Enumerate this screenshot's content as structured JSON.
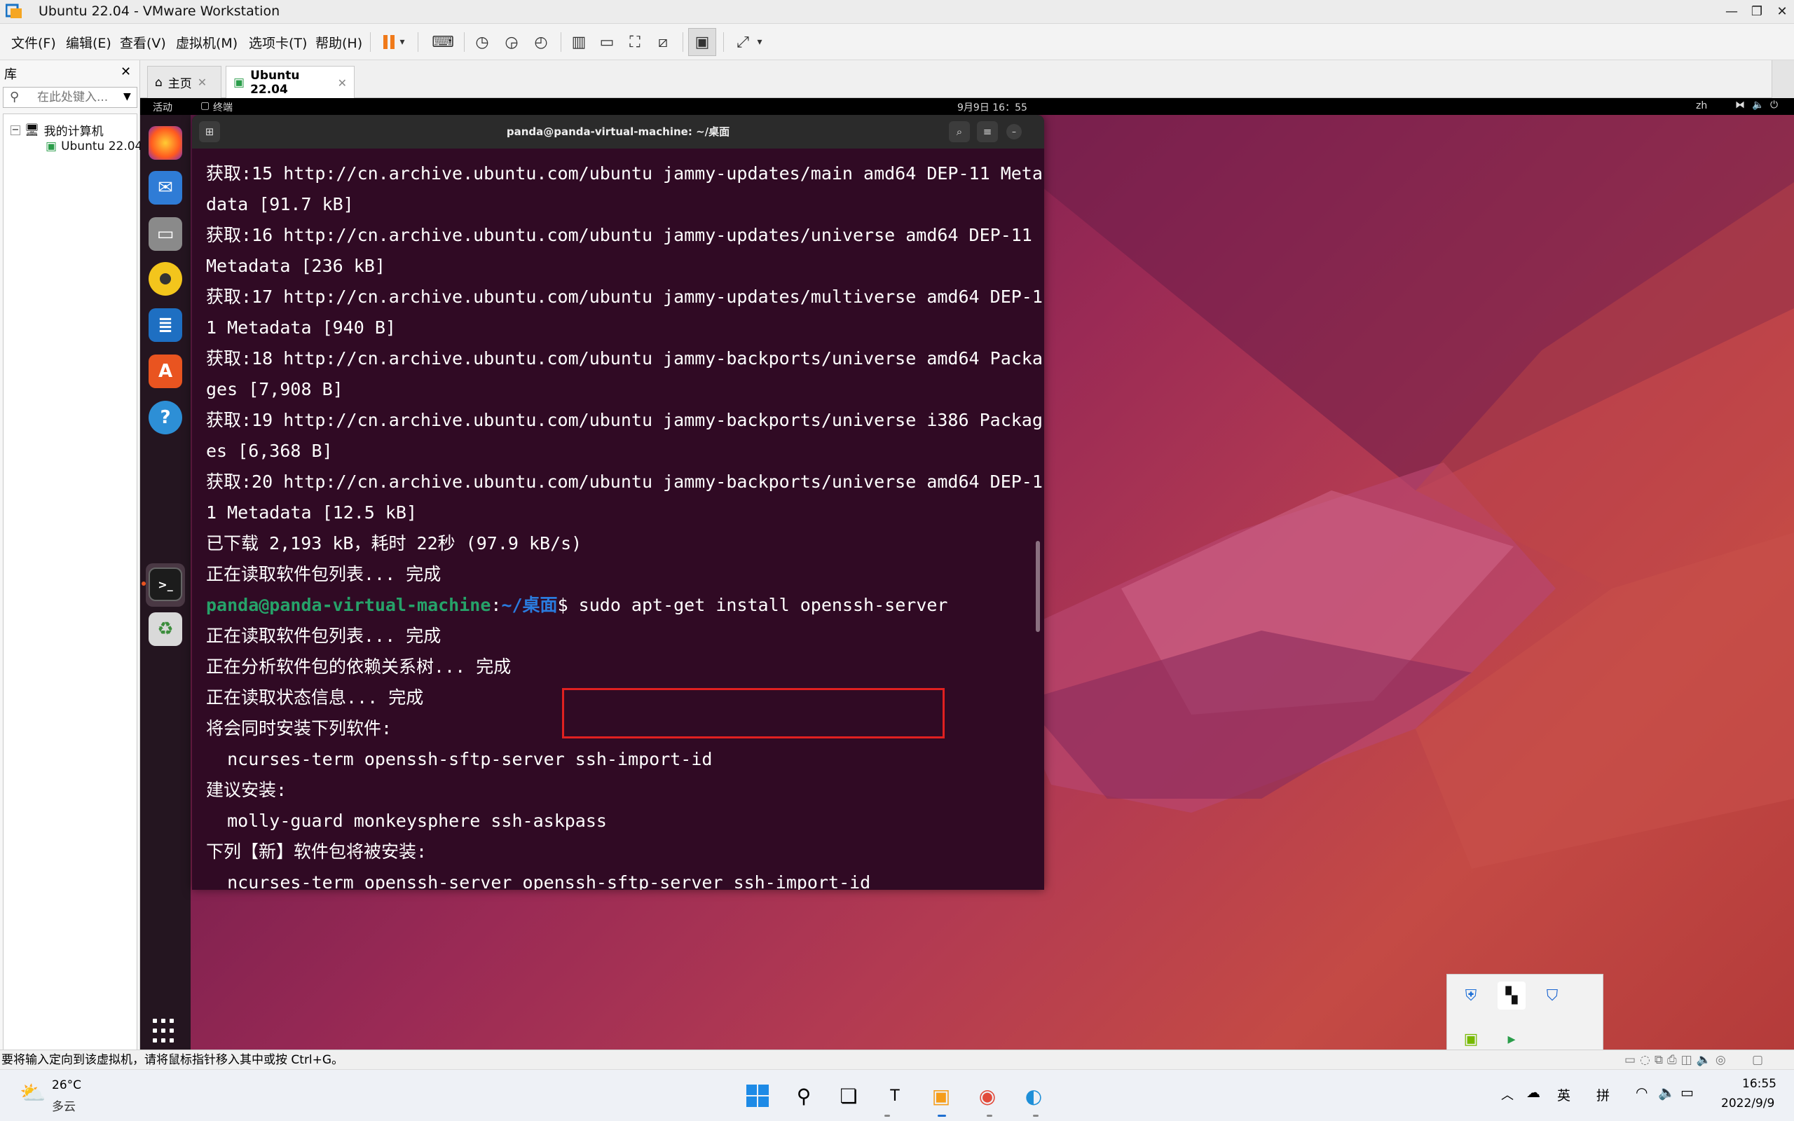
{
  "window": {
    "title": "Ubuntu 22.04 - VMware Workstation"
  },
  "menus": [
    "文件(F)",
    "编辑(E)",
    "查看(V)",
    "虚拟机(M)",
    "选项卡(T)",
    "帮助(H)"
  ],
  "library": {
    "header": "库",
    "search_placeholder": "在此处键入...",
    "tree": [
      "我的计算机",
      "Ubuntu 22.04"
    ]
  },
  "tabs": [
    {
      "label": "主页"
    },
    {
      "label": "Ubuntu 22.04"
    }
  ],
  "ubuntu": {
    "activities": "活动",
    "app_name": "终端",
    "clock": "9月9日 16：55",
    "lang": "zh"
  },
  "terminal": {
    "title": "panda@panda-virtual-machine: ~/桌面",
    "lines": [
      "获取:15 http://cn.archive.ubuntu.com/ubuntu jammy-updates/main amd64 DEP-11 Meta",
      "data [91.7 kB]",
      "获取:16 http://cn.archive.ubuntu.com/ubuntu jammy-updates/universe amd64 DEP-11",
      "Metadata [236 kB]",
      "获取:17 http://cn.archive.ubuntu.com/ubuntu jammy-updates/multiverse amd64 DEP-1",
      "1 Metadata [940 B]",
      "获取:18 http://cn.archive.ubuntu.com/ubuntu jammy-backports/universe amd64 Packa",
      "ges [7,908 B]",
      "获取:19 http://cn.archive.ubuntu.com/ubuntu jammy-backports/universe i386 Packag",
      "es [6,368 B]",
      "获取:20 http://cn.archive.ubuntu.com/ubuntu jammy-backports/universe amd64 DEP-1",
      "1 Metadata [12.5 kB]",
      "已下载 2,193 kB，耗时 22秒 (97.9 kB/s)",
      "正在读取软件包列表... 完成"
    ],
    "prompt_user": "panda@panda-virtual-machine",
    "prompt_sep": ":",
    "prompt_path": "~/桌面",
    "prompt_dollar": "$ ",
    "command": "sudo apt-get install openssh-server",
    "after_lines": [
      "正在读取软件包列表... 完成",
      "正在分析软件包的依赖关系树... 完成",
      "正在读取状态信息... 完成",
      "将会同时安装下列软件:",
      "  ncurses-term openssh-sftp-server ssh-import-id",
      "建议安装:",
      "  molly-guard monkeysphere ssh-askpass",
      "下列【新】软件包将被安装:",
      "  ncurses-term openssh-server openssh-sftp-server ssh-import-id"
    ]
  },
  "status_bar": "要将输入定向到该虚拟机，请将鼠标指针移入其中或按 Ctrl+G。",
  "taskbar": {
    "weather_temp": "26°C",
    "weather_desc": "多云",
    "ime_lang": "英",
    "ime_mode": "拼",
    "time": "16:55",
    "date": "2022/9/9"
  },
  "colors": {
    "accent_red": "#e02020",
    "ubuntu_orange": "#e95420",
    "terminal_bg": "#300a24"
  }
}
